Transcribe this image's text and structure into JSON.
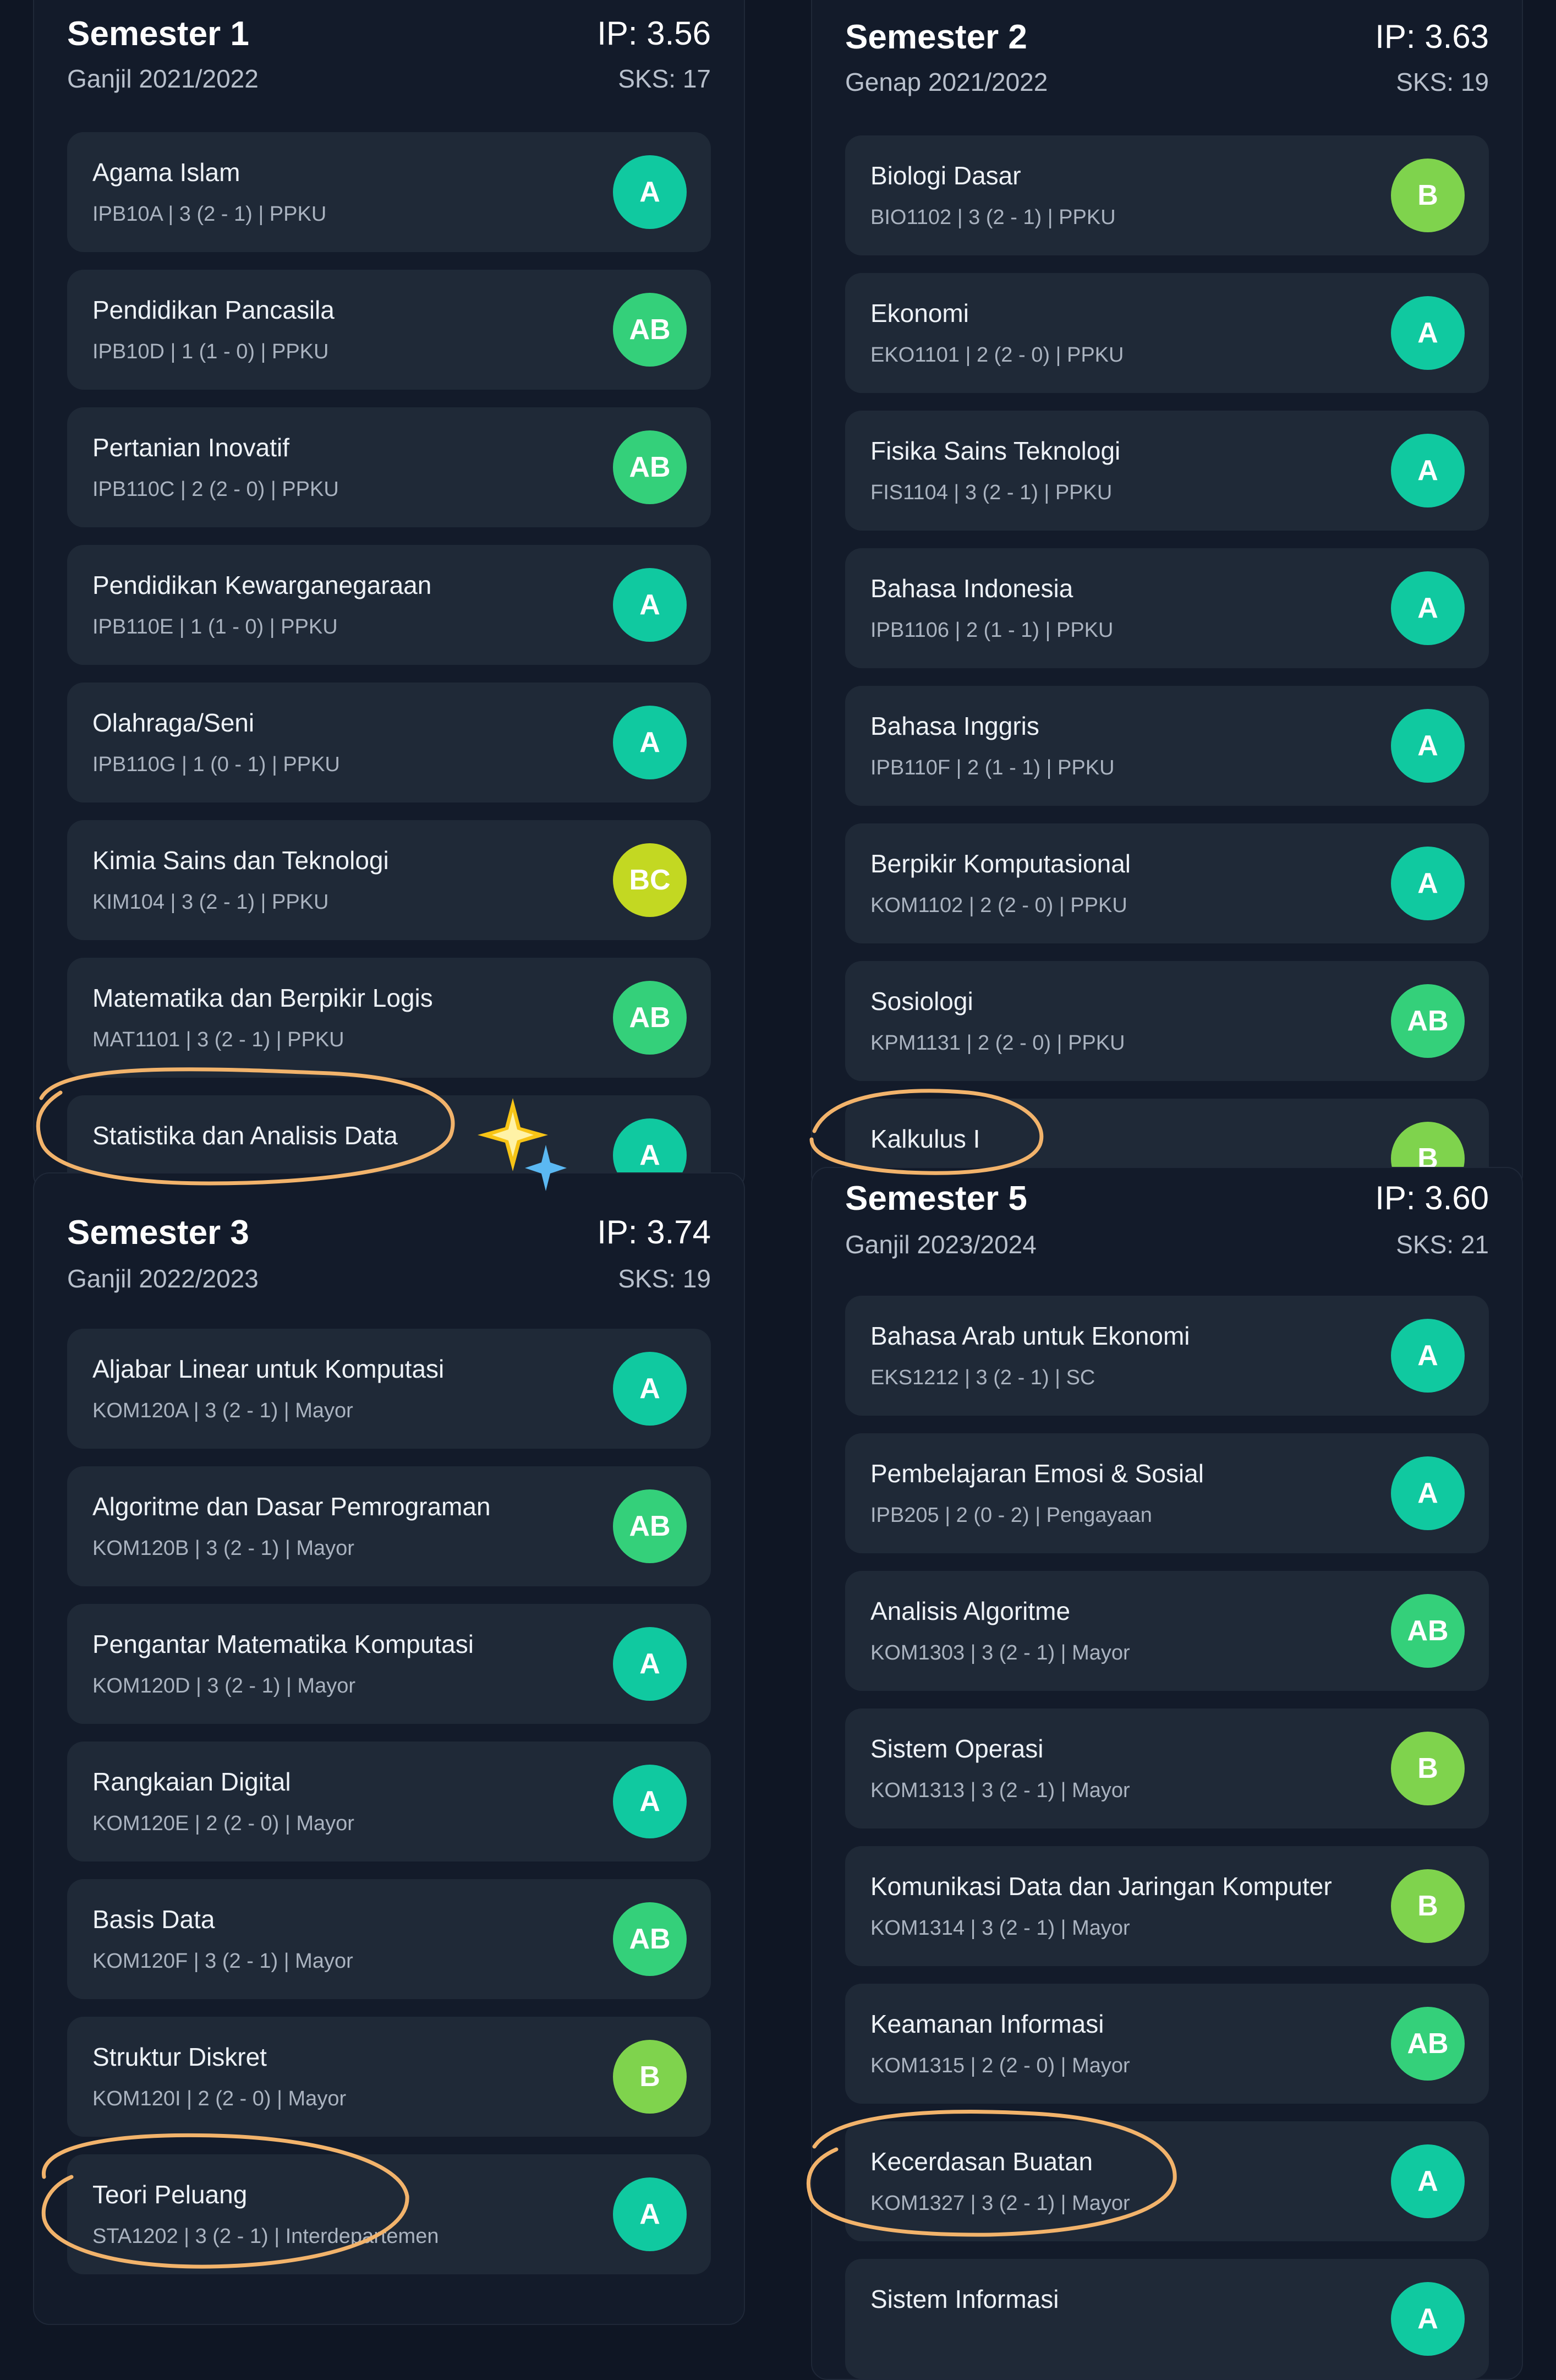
{
  "grade_colors": {
    "A": "#10c9a0",
    "AB": "#34d07a",
    "B": "#7fd34d",
    "BC": "#c3d822"
  },
  "semesters": [
    {
      "title": "Semester 1",
      "ip": "IP: 3.56",
      "period": "Ganjil 2021/2022",
      "sks": "SKS: 17",
      "courses": [
        {
          "name": "Agama Islam",
          "meta": "IPB10A | 3 (2 - 1) | PPKU",
          "grade": "A"
        },
        {
          "name": "Pendidikan Pancasila",
          "meta": "IPB10D | 1 (1 - 0) | PPKU",
          "grade": "AB"
        },
        {
          "name": "Pertanian Inovatif",
          "meta": "IPB110C | 2 (2 - 0) | PPKU",
          "grade": "AB"
        },
        {
          "name": "Pendidikan Kewarganegaraan",
          "meta": "IPB110E | 1 (1 - 0) | PPKU",
          "grade": "A"
        },
        {
          "name": "Olahraga/Seni",
          "meta": "IPB110G | 1 (0 - 1) | PPKU",
          "grade": "A"
        },
        {
          "name": "Kimia Sains dan Teknologi",
          "meta": "KIM104 | 3 (2 - 1) | PPKU",
          "grade": "BC"
        },
        {
          "name": "Matematika dan Berpikir Logis",
          "meta": "MAT1101 | 3 (2 - 1) | PPKU",
          "grade": "AB"
        },
        {
          "name": "Statistika dan Analisis Data",
          "meta": "",
          "grade": "A"
        }
      ]
    },
    {
      "title": "Semester 2",
      "ip": "IP: 3.63",
      "period": "Genap 2021/2022",
      "sks": "SKS: 19",
      "courses": [
        {
          "name": "Biologi Dasar",
          "meta": "BIO1102 | 3 (2 - 1) | PPKU",
          "grade": "B"
        },
        {
          "name": "Ekonomi",
          "meta": "EKO1101 | 2 (2 - 0) | PPKU",
          "grade": "A"
        },
        {
          "name": "Fisika Sains Teknologi",
          "meta": "FIS1104 | 3 (2 - 1) | PPKU",
          "grade": "A"
        },
        {
          "name": "Bahasa Indonesia",
          "meta": "IPB1106 | 2 (1 - 1) | PPKU",
          "grade": "A"
        },
        {
          "name": "Bahasa Inggris",
          "meta": "IPB110F | 2 (1 - 1) | PPKU",
          "grade": "A"
        },
        {
          "name": "Berpikir Komputasional",
          "meta": "KOM1102 | 2 (2 - 0) | PPKU",
          "grade": "A"
        },
        {
          "name": "Sosiologi",
          "meta": "KPM1131 | 2 (2 - 0) | PPKU",
          "grade": "AB"
        },
        {
          "name": "Kalkulus I",
          "meta": "",
          "grade": "B"
        }
      ]
    },
    {
      "title": "Semester 3",
      "ip": "IP: 3.74",
      "period": "Ganjil 2022/2023",
      "sks": "SKS: 19",
      "courses": [
        {
          "name": "Aljabar Linear untuk Komputasi",
          "meta": "KOM120A | 3 (2 - 1) | Mayor",
          "grade": "A"
        },
        {
          "name": "Algoritme dan Dasar Pemrograman",
          "meta": "KOM120B | 3 (2 - 1) | Mayor",
          "grade": "AB"
        },
        {
          "name": "Pengantar Matematika Komputasi",
          "meta": "KOM120D | 3 (2 - 1) | Mayor",
          "grade": "A"
        },
        {
          "name": "Rangkaian Digital",
          "meta": "KOM120E | 2 (2 - 0) | Mayor",
          "grade": "A"
        },
        {
          "name": "Basis Data",
          "meta": "KOM120F | 3 (2 - 1) | Mayor",
          "grade": "AB"
        },
        {
          "name": "Struktur Diskret",
          "meta": "KOM120I | 2 (2 - 0) | Mayor",
          "grade": "B"
        },
        {
          "name": "Teori Peluang",
          "meta": "STA1202 | 3 (2 - 1) | Interdepartemen",
          "grade": "A"
        }
      ]
    },
    {
      "title": "Semester 5",
      "ip": "IP: 3.60",
      "period": "Ganjil 2023/2024",
      "sks": "SKS: 21",
      "courses": [
        {
          "name": "Bahasa Arab untuk Ekonomi",
          "meta": "EKS1212 | 3 (2 - 1) | SC",
          "grade": "A"
        },
        {
          "name": "Pembelajaran Emosi & Sosial",
          "meta": "IPB205 | 2 (0 - 2) | Pengayaan",
          "grade": "A"
        },
        {
          "name": "Analisis Algoritme",
          "meta": "KOM1303 | 3 (2 - 1) | Mayor",
          "grade": "AB"
        },
        {
          "name": "Sistem Operasi",
          "meta": "KOM1313 | 3 (2 - 1) | Mayor",
          "grade": "B"
        },
        {
          "name": "Komunikasi Data dan Jaringan Komputer",
          "meta": "KOM1314 | 3 (2 - 1) | Mayor",
          "grade": "B"
        },
        {
          "name": "Keamanan Informasi",
          "meta": "KOM1315 | 2 (2 - 0) | Mayor",
          "grade": "AB"
        },
        {
          "name": "Kecerdasan Buatan",
          "meta": "KOM1327 | 3 (2 - 1) | Mayor",
          "grade": "A"
        },
        {
          "name": "Sistem Informasi",
          "meta": "",
          "grade": "A"
        }
      ]
    }
  ]
}
